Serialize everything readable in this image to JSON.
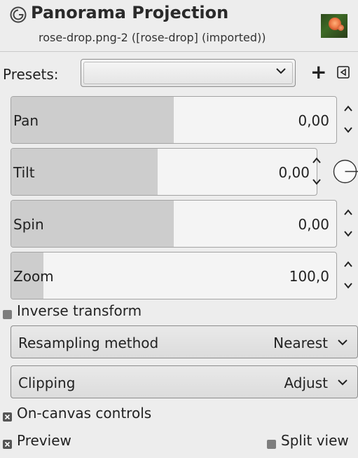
{
  "header": {
    "title": "Panorama Projection",
    "subtitle": "rose-drop.png-2 ([rose-drop] (imported))",
    "icon": "gimp-swirl-icon",
    "thumbnail": "rose-image-thumbnail"
  },
  "presets": {
    "label": "Presets:",
    "value": "",
    "add_label": "+"
  },
  "fields": [
    {
      "label": "Pan",
      "value": "0,00",
      "fill_fraction": 0.5
    },
    {
      "label": "Tilt",
      "value": "0,00",
      "fill_fraction": 0.48
    },
    {
      "label": "Spin",
      "value": "0,00",
      "fill_fraction": 0.5
    },
    {
      "label": "Zoom",
      "value": "100,0",
      "fill_fraction": 0.1
    }
  ],
  "inverse_transform": {
    "label": "Inverse transform",
    "checked": false
  },
  "resampling": {
    "label": "Resampling method",
    "value": "Nearest"
  },
  "clipping": {
    "label": "Clipping",
    "value": "Adjust"
  },
  "on_canvas": {
    "label": "On-canvas controls",
    "checked": true
  },
  "preview": {
    "label": "Preview",
    "checked": true
  },
  "split_view": {
    "label": "Split view",
    "checked": false
  },
  "colors": {
    "background": "#ededed",
    "field_fill": "#cdcdcd",
    "field_bg": "#f4f4f4"
  }
}
